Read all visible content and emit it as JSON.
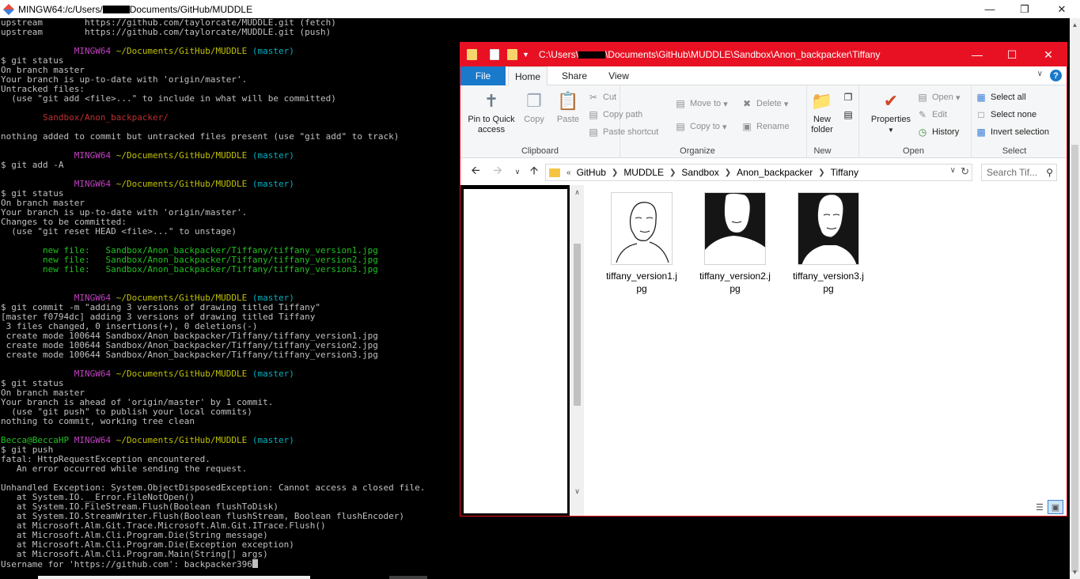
{
  "terminal": {
    "title_prefix": "MINGW64:/c/Users/",
    "title_suffix": "Documents/GitHub/MUDDLE",
    "lines": [
      [
        {
          "t": "upstream        https://github.com/taylorcate/MUDDLE.git (fetch)"
        }
      ],
      [
        {
          "t": "upstream        https://github.com/taylorcate/MUDDLE.git (push)"
        }
      ],
      [
        {
          "t": ""
        }
      ],
      [
        {
          "t": "              "
        },
        {
          "t": "MINGW64",
          "c": "mag"
        },
        {
          "t": " ~/Documents/GitHub/MUDDLE",
          "c": "yel"
        },
        {
          "t": " (master)",
          "c": "cyn"
        }
      ],
      [
        {
          "t": "$ git status"
        }
      ],
      [
        {
          "t": "On branch master"
        }
      ],
      [
        {
          "t": "Your branch is up-to-date with 'origin/master'."
        }
      ],
      [
        {
          "t": "Untracked files:"
        }
      ],
      [
        {
          "t": "  (use \"git add <file>...\" to include in what will be committed)"
        }
      ],
      [
        {
          "t": ""
        }
      ],
      [
        {
          "t": "        "
        },
        {
          "t": "Sandbox/Anon_backpacker/",
          "c": "red"
        }
      ],
      [
        {
          "t": ""
        }
      ],
      [
        {
          "t": "nothing added to commit but untracked files present (use \"git add\" to track)"
        }
      ],
      [
        {
          "t": ""
        }
      ],
      [
        {
          "t": "              "
        },
        {
          "t": "MINGW64",
          "c": "mag"
        },
        {
          "t": " ~/Documents/GitHub/MUDDLE",
          "c": "yel"
        },
        {
          "t": " (master)",
          "c": "cyn"
        }
      ],
      [
        {
          "t": "$ git add -A"
        }
      ],
      [
        {
          "t": ""
        }
      ],
      [
        {
          "t": "              "
        },
        {
          "t": "MINGW64",
          "c": "mag"
        },
        {
          "t": " ~/Documents/GitHub/MUDDLE",
          "c": "yel"
        },
        {
          "t": " (master)",
          "c": "cyn"
        }
      ],
      [
        {
          "t": "$ git status"
        }
      ],
      [
        {
          "t": "On branch master"
        }
      ],
      [
        {
          "t": "Your branch is up-to-date with 'origin/master'."
        }
      ],
      [
        {
          "t": "Changes to be committed:"
        }
      ],
      [
        {
          "t": "  (use \"git reset HEAD <file>...\" to unstage)"
        }
      ],
      [
        {
          "t": ""
        }
      ],
      [
        {
          "t": "        "
        },
        {
          "t": "new file:   Sandbox/Anon_backpacker/Tiffany/tiffany_version1.jpg",
          "c": "grn"
        }
      ],
      [
        {
          "t": "        "
        },
        {
          "t": "new file:   Sandbox/Anon_backpacker/Tiffany/tiffany_version2.jpg",
          "c": "grn"
        }
      ],
      [
        {
          "t": "        "
        },
        {
          "t": "new file:   Sandbox/Anon_backpacker/Tiffany/tiffany_version3.jpg",
          "c": "grn"
        }
      ],
      [
        {
          "t": ""
        }
      ],
      [
        {
          "t": ""
        }
      ],
      [
        {
          "t": "              "
        },
        {
          "t": "MINGW64",
          "c": "mag"
        },
        {
          "t": " ~/Documents/GitHub/MUDDLE",
          "c": "yel"
        },
        {
          "t": " (master)",
          "c": "cyn"
        }
      ],
      [
        {
          "t": "$ git commit -m \"adding 3 versions of drawing titled Tiffany\""
        }
      ],
      [
        {
          "t": "[master f0794dc] adding 3 versions of drawing titled Tiffany"
        }
      ],
      [
        {
          "t": " 3 files changed, 0 insertions(+), 0 deletions(-)"
        }
      ],
      [
        {
          "t": " create mode 100644 Sandbox/Anon_backpacker/Tiffany/tiffany_version1.jpg"
        }
      ],
      [
        {
          "t": " create mode 100644 Sandbox/Anon_backpacker/Tiffany/tiffany_version2.jpg"
        }
      ],
      [
        {
          "t": " create mode 100644 Sandbox/Anon_backpacker/Tiffany/tiffany_version3.jpg"
        }
      ],
      [
        {
          "t": ""
        }
      ],
      [
        {
          "t": "              "
        },
        {
          "t": "MINGW64",
          "c": "mag"
        },
        {
          "t": " ~/Documents/GitHub/MUDDLE",
          "c": "yel"
        },
        {
          "t": " (master)",
          "c": "cyn"
        }
      ],
      [
        {
          "t": "$ git status"
        }
      ],
      [
        {
          "t": "On branch master"
        }
      ],
      [
        {
          "t": "Your branch is ahead of 'origin/master' by 1 commit."
        }
      ],
      [
        {
          "t": "  (use \"git push\" to publish your local commits)"
        }
      ],
      [
        {
          "t": "nothing to commit, working tree clean"
        }
      ],
      [
        {
          "t": ""
        }
      ],
      [
        {
          "t": "Becca@BeccaHP",
          "c": "grn"
        },
        {
          "t": " "
        },
        {
          "t": "MINGW64",
          "c": "mag"
        },
        {
          "t": " ~/Documents/GitHub/MUDDLE",
          "c": "yel"
        },
        {
          "t": " (master)",
          "c": "cyn"
        }
      ],
      [
        {
          "t": "$ git push"
        }
      ],
      [
        {
          "t": "fatal: HttpRequestException encountered."
        }
      ],
      [
        {
          "t": "   An error occurred while sending the request."
        }
      ],
      [
        {
          "t": ""
        }
      ],
      [
        {
          "t": "Unhandled Exception: System.ObjectDisposedException: Cannot access a closed file."
        }
      ],
      [
        {
          "t": "   at System.IO.__Error.FileNotOpen()"
        }
      ],
      [
        {
          "t": "   at System.IO.FileStream.Flush(Boolean flushToDisk)"
        }
      ],
      [
        {
          "t": "   at System.IO.StreamWriter.Flush(Boolean flushStream, Boolean flushEncoder)"
        }
      ],
      [
        {
          "t": "   at Microsoft.Alm.Git.Trace.Microsoft.Alm.Git.ITrace.Flush()"
        }
      ],
      [
        {
          "t": "   at Microsoft.Alm.Cli.Program.Die(String message)"
        }
      ],
      [
        {
          "t": "   at Microsoft.Alm.Cli.Program.Die(Exception exception)"
        }
      ],
      [
        {
          "t": "   at Microsoft.Alm.Cli.Program.Main(String[] args)"
        }
      ],
      [
        {
          "t": "Username for 'https://github.com': backpacker396"
        }
      ]
    ],
    "colors": {
      "mag": "#c040c0",
      "yel": "#c0c000",
      "cyn": "#00b0c0",
      "red": "#c03030",
      "grn": "#20c020"
    }
  },
  "explorer": {
    "title_prefix": "C:\\Users\\",
    "title_suffix": "\\Documents\\GitHub\\MUDDLE\\Sandbox\\Anon_backpacker\\Tiffany",
    "accent": "#e81123",
    "tabs": {
      "file": "File",
      "home": "Home",
      "share": "Share",
      "view": "View"
    },
    "help": "?",
    "ribbon": {
      "clipboard": {
        "label": "Clipboard",
        "pin": "Pin to Quick access",
        "copy": "Copy",
        "paste": "Paste",
        "cut": "Cut",
        "copy_path": "Copy path",
        "paste_shortcut": "Paste shortcut"
      },
      "organize": {
        "label": "Organize",
        "move_to": "Move to",
        "copy_to": "Copy to",
        "delete": "Delete",
        "rename": "Rename"
      },
      "new": {
        "label": "New",
        "new_folder": "New folder"
      },
      "open": {
        "label": "Open",
        "properties": "Properties",
        "open": "Open",
        "edit": "Edit",
        "history": "History"
      },
      "select": {
        "label": "Select",
        "select_all": "Select all",
        "select_none": "Select none",
        "invert": "Invert selection"
      }
    },
    "address": {
      "overflow": "«",
      "crumbs": [
        "GitHub",
        "MUDDLE",
        "Sandbox",
        "Anon_backpacker",
        "Tiffany"
      ]
    },
    "search_placeholder": "Search Tif...",
    "files": [
      {
        "name": "tiffany_version1.jpg",
        "style": "light"
      },
      {
        "name": "tiffany_version2.jpg",
        "style": "dark"
      },
      {
        "name": "tiffany_version3.jpg",
        "style": "dark"
      }
    ]
  }
}
